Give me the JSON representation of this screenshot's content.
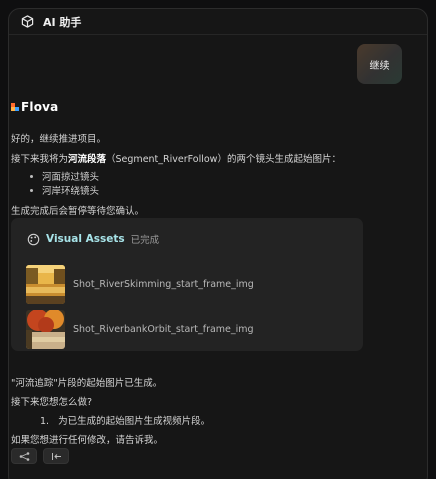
{
  "header": {
    "title": "AI 助手",
    "icon": "cube-icon"
  },
  "user_message": "继续",
  "assistant": {
    "brand": "Flova",
    "brand_colors": {
      "mark_orange": "#ff6a2b",
      "mark_blue": "#3aa0ff"
    },
    "line1": "好的，继续推进项目。",
    "line2_prefix": "接下来我将为",
    "line2_bold": "河流段落",
    "line2_suffix": "（Segment_RiverFollow）的两个镜头生成起始图片：",
    "bullets": [
      "河面掠过镜头",
      "河岸环绕镜头"
    ],
    "line3": "生成完成后会暂停等待您确认。"
  },
  "visual_assets": {
    "heading": "Visual Assets",
    "status": "已完成",
    "heading_color": "#a7e3e8",
    "items": [
      {
        "name": "Shot_RiverSkimming_start_frame_img"
      },
      {
        "name": "Shot_RiverbankOrbit_start_frame_img"
      }
    ]
  },
  "followup": {
    "line1": "\"河流追踪\"片段的起始图片已生成。",
    "line2": "接下来您想怎么做?",
    "numbered": [
      {
        "num": "1.",
        "text": "为已生成的起始图片生成视频片段。"
      }
    ],
    "line3": "如果您想进行任何修改，请告诉我。"
  },
  "actions": [
    {
      "name": "share-icon"
    },
    {
      "name": "back-to-start-icon"
    }
  ]
}
